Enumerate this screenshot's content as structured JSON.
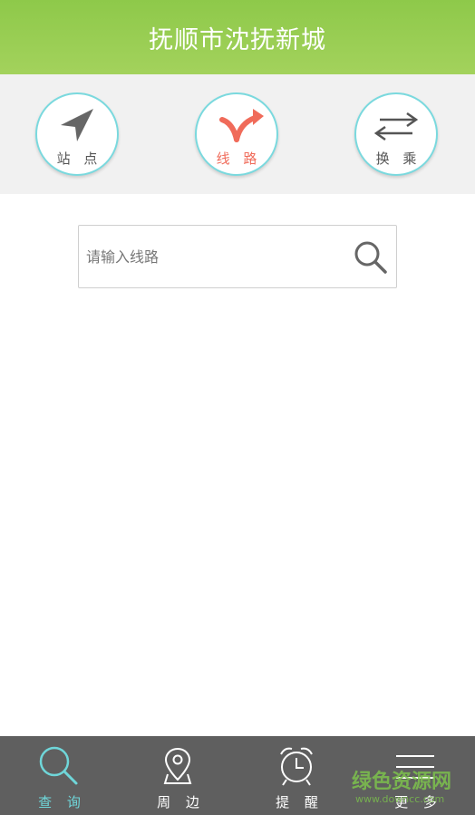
{
  "header": {
    "title": "抚顺市沈抚新城"
  },
  "modes": [
    {
      "label": "站 点",
      "icon": "navigation-arrow-icon",
      "active": false
    },
    {
      "label": "线 路",
      "icon": "route-fork-icon",
      "active": true
    },
    {
      "label": "换 乘",
      "icon": "transfer-arrows-icon",
      "active": false
    }
  ],
  "search": {
    "placeholder": "请输入线路",
    "value": ""
  },
  "bottom_nav": [
    {
      "label": "查 询",
      "icon": "search-icon",
      "active": true
    },
    {
      "label": "周 边",
      "icon": "map-pin-icon",
      "active": false
    },
    {
      "label": "提 醒",
      "icon": "alarm-clock-icon",
      "active": false
    },
    {
      "label": "更 多",
      "icon": "menu-lines-icon",
      "active": false
    }
  ],
  "watermark": {
    "text": "绿色资源网",
    "subtext": "www.downcc.com"
  },
  "colors": {
    "header": "#9bcf54",
    "accent_teal": "#6fd6d9",
    "active_red": "#f06b5a",
    "nav_bg": "#5f5f5f"
  }
}
